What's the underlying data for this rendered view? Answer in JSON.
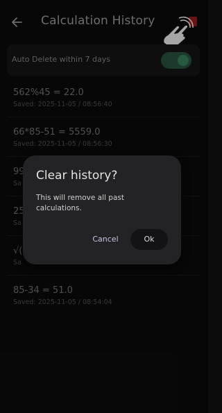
{
  "header": {
    "title": "Calculation History",
    "back_icon": "arrow-left-icon",
    "action_icon": "delete-icon",
    "tap_hint_icon": "tap-hand-icon"
  },
  "auto_delete": {
    "label": "Auto Delete within 7 days",
    "enabled": true,
    "toggle_color": "#3a8b5f"
  },
  "history": [
    {
      "expression": "562%45 = 22.0",
      "saved": "Saved: 2025-11-05 / 08:56:40"
    },
    {
      "expression": "66*85-51 = 5559.0",
      "saved": "Saved: 2025-11-05 / 08:56:30"
    },
    {
      "expression": "99",
      "saved": "Sa"
    },
    {
      "expression": "25",
      "saved": "Sa"
    },
    {
      "expression": "√(",
      "saved": "Sa"
    },
    {
      "expression": "85-34 = 51.0",
      "saved": "Saved: 2025-11-05 / 08:54:04"
    }
  ],
  "dialog": {
    "title": "Clear history?",
    "message": "This will remove all past calculations.",
    "cancel_label": "Cancel",
    "ok_label": "Ok"
  }
}
